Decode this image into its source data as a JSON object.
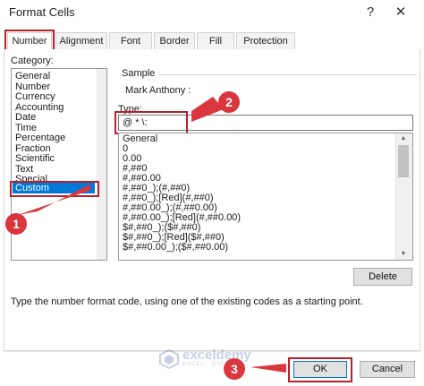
{
  "window": {
    "title": "Format Cells",
    "help_label": "?",
    "close_label": "✕"
  },
  "tabs": [
    {
      "label": "Number",
      "active": true
    },
    {
      "label": "Alignment"
    },
    {
      "label": "Font"
    },
    {
      "label": "Border"
    },
    {
      "label": "Fill"
    },
    {
      "label": "Protection"
    }
  ],
  "category": {
    "label": "Category:",
    "items": [
      "General",
      "Number",
      "Currency",
      "Accounting",
      "Date",
      "Time",
      "Percentage",
      "Fraction",
      "Scientific",
      "Text",
      "Special",
      "Custom"
    ],
    "selected": "Custom"
  },
  "sample": {
    "label": "Sample",
    "value": "Mark Anthony :"
  },
  "type": {
    "label": "Type:",
    "value": "@ * \\:",
    "formats": [
      "General",
      "0",
      "0.00",
      "#,##0",
      "#,##0.00",
      "#,##0_);(#,##0)",
      "#,##0_);[Red](#,##0)",
      "#,##0.00_);(#,##0.00)",
      "#,##0.00_);[Red](#,##0.00)",
      "$#,##0_);($#,##0)",
      "$#,##0_);[Red]($#,##0)",
      "$#,##0.00_);($#,##0.00)"
    ]
  },
  "buttons": {
    "delete": "Delete",
    "ok": "OK",
    "cancel": "Cancel"
  },
  "description": "Type the number format code, using one of the existing codes as a starting point.",
  "annotations": {
    "step1": "1",
    "step2": "2",
    "step3": "3"
  },
  "watermark": {
    "name": "exceldemy",
    "tagline": "EXCEL · DATA · BI"
  },
  "colors": {
    "highlight": "#b8202a",
    "badge": "#d9363e",
    "selection": "#0078d7"
  }
}
